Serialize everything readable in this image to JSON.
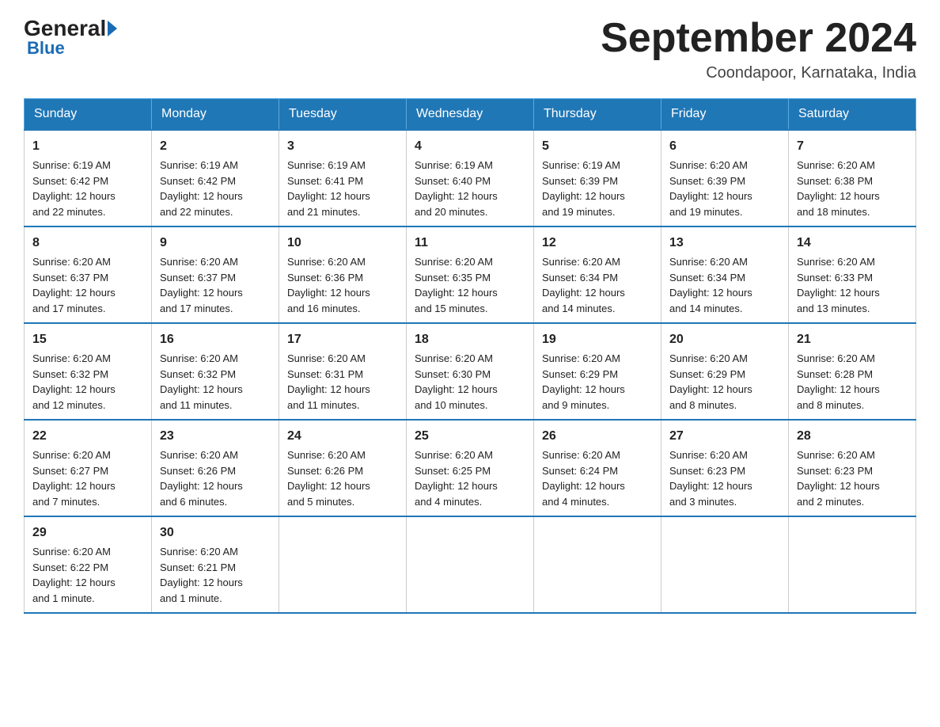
{
  "header": {
    "logo_general": "General",
    "logo_blue": "Blue",
    "month_title": "September 2024",
    "location": "Coondapoor, Karnataka, India"
  },
  "days_of_week": [
    "Sunday",
    "Monday",
    "Tuesday",
    "Wednesday",
    "Thursday",
    "Friday",
    "Saturday"
  ],
  "weeks": [
    [
      {
        "day": "1",
        "sunrise": "6:19 AM",
        "sunset": "6:42 PM",
        "daylight": "12 hours and 22 minutes."
      },
      {
        "day": "2",
        "sunrise": "6:19 AM",
        "sunset": "6:42 PM",
        "daylight": "12 hours and 22 minutes."
      },
      {
        "day": "3",
        "sunrise": "6:19 AM",
        "sunset": "6:41 PM",
        "daylight": "12 hours and 21 minutes."
      },
      {
        "day": "4",
        "sunrise": "6:19 AM",
        "sunset": "6:40 PM",
        "daylight": "12 hours and 20 minutes."
      },
      {
        "day": "5",
        "sunrise": "6:19 AM",
        "sunset": "6:39 PM",
        "daylight": "12 hours and 19 minutes."
      },
      {
        "day": "6",
        "sunrise": "6:20 AM",
        "sunset": "6:39 PM",
        "daylight": "12 hours and 19 minutes."
      },
      {
        "day": "7",
        "sunrise": "6:20 AM",
        "sunset": "6:38 PM",
        "daylight": "12 hours and 18 minutes."
      }
    ],
    [
      {
        "day": "8",
        "sunrise": "6:20 AM",
        "sunset": "6:37 PM",
        "daylight": "12 hours and 17 minutes."
      },
      {
        "day": "9",
        "sunrise": "6:20 AM",
        "sunset": "6:37 PM",
        "daylight": "12 hours and 17 minutes."
      },
      {
        "day": "10",
        "sunrise": "6:20 AM",
        "sunset": "6:36 PM",
        "daylight": "12 hours and 16 minutes."
      },
      {
        "day": "11",
        "sunrise": "6:20 AM",
        "sunset": "6:35 PM",
        "daylight": "12 hours and 15 minutes."
      },
      {
        "day": "12",
        "sunrise": "6:20 AM",
        "sunset": "6:34 PM",
        "daylight": "12 hours and 14 minutes."
      },
      {
        "day": "13",
        "sunrise": "6:20 AM",
        "sunset": "6:34 PM",
        "daylight": "12 hours and 14 minutes."
      },
      {
        "day": "14",
        "sunrise": "6:20 AM",
        "sunset": "6:33 PM",
        "daylight": "12 hours and 13 minutes."
      }
    ],
    [
      {
        "day": "15",
        "sunrise": "6:20 AM",
        "sunset": "6:32 PM",
        "daylight": "12 hours and 12 minutes."
      },
      {
        "day": "16",
        "sunrise": "6:20 AM",
        "sunset": "6:32 PM",
        "daylight": "12 hours and 11 minutes."
      },
      {
        "day": "17",
        "sunrise": "6:20 AM",
        "sunset": "6:31 PM",
        "daylight": "12 hours and 11 minutes."
      },
      {
        "day": "18",
        "sunrise": "6:20 AM",
        "sunset": "6:30 PM",
        "daylight": "12 hours and 10 minutes."
      },
      {
        "day": "19",
        "sunrise": "6:20 AM",
        "sunset": "6:29 PM",
        "daylight": "12 hours and 9 minutes."
      },
      {
        "day": "20",
        "sunrise": "6:20 AM",
        "sunset": "6:29 PM",
        "daylight": "12 hours and 8 minutes."
      },
      {
        "day": "21",
        "sunrise": "6:20 AM",
        "sunset": "6:28 PM",
        "daylight": "12 hours and 8 minutes."
      }
    ],
    [
      {
        "day": "22",
        "sunrise": "6:20 AM",
        "sunset": "6:27 PM",
        "daylight": "12 hours and 7 minutes."
      },
      {
        "day": "23",
        "sunrise": "6:20 AM",
        "sunset": "6:26 PM",
        "daylight": "12 hours and 6 minutes."
      },
      {
        "day": "24",
        "sunrise": "6:20 AM",
        "sunset": "6:26 PM",
        "daylight": "12 hours and 5 minutes."
      },
      {
        "day": "25",
        "sunrise": "6:20 AM",
        "sunset": "6:25 PM",
        "daylight": "12 hours and 4 minutes."
      },
      {
        "day": "26",
        "sunrise": "6:20 AM",
        "sunset": "6:24 PM",
        "daylight": "12 hours and 4 minutes."
      },
      {
        "day": "27",
        "sunrise": "6:20 AM",
        "sunset": "6:23 PM",
        "daylight": "12 hours and 3 minutes."
      },
      {
        "day": "28",
        "sunrise": "6:20 AM",
        "sunset": "6:23 PM",
        "daylight": "12 hours and 2 minutes."
      }
    ],
    [
      {
        "day": "29",
        "sunrise": "6:20 AM",
        "sunset": "6:22 PM",
        "daylight": "12 hours and 1 minute."
      },
      {
        "day": "30",
        "sunrise": "6:20 AM",
        "sunset": "6:21 PM",
        "daylight": "12 hours and 1 minute."
      },
      null,
      null,
      null,
      null,
      null
    ]
  ],
  "labels": {
    "sunrise": "Sunrise:",
    "sunset": "Sunset:",
    "daylight": "Daylight:"
  }
}
